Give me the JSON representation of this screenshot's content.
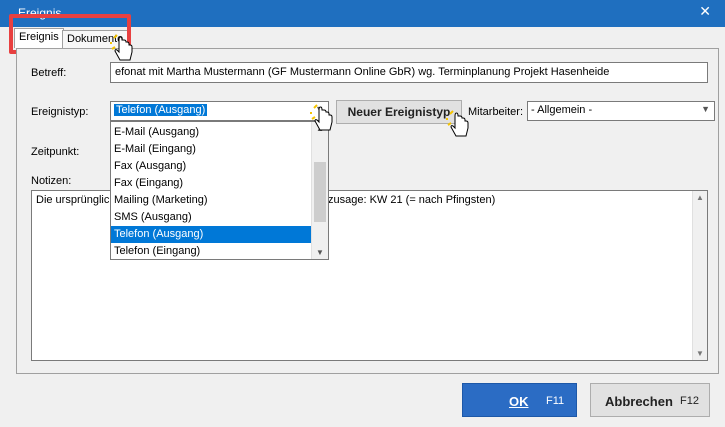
{
  "window": {
    "title": "Ereignis",
    "close_glyph": "✕"
  },
  "tabs": [
    {
      "label": "Ereignis",
      "active": true
    },
    {
      "label": "Dokumente",
      "active": false
    }
  ],
  "form": {
    "betreff_label": "Betreff:",
    "betreff_value": "Telefonat mit Martha Mustermann (GF Mustermann Online GbR) wg. Terminplanung Projekt Hasenheide",
    "betreff_visible": "efonat mit Martha Mustermann (GF Mustermann Online GbR) wg. Terminplanung Projekt Hasenheide",
    "ereignistyp_label": "Ereignistyp:",
    "ereignistyp_value": "Telefon (Ausgang)",
    "neuer_ereignistyp_button": "Neuer Ereignistyp",
    "mitarbeiter_label": "Mitarbeiter:",
    "mitarbeiter_value": "- Allgemein -",
    "zeitpunkt_label": "Zeitpunkt:",
    "notizen_label": "Notizen:",
    "notizen_left": "Die ursprüngliche",
    "notizen_right": "zusage: KW 21 (= nach Pfingsten)"
  },
  "dropdown": {
    "items": [
      {
        "label": "E-Mail (Ausgang)",
        "selected": false
      },
      {
        "label": "E-Mail (Eingang)",
        "selected": false
      },
      {
        "label": "Fax (Ausgang)",
        "selected": false
      },
      {
        "label": "Fax (Eingang)",
        "selected": false
      },
      {
        "label": "Mailing (Marketing)",
        "selected": false
      },
      {
        "label": "SMS (Ausgang)",
        "selected": false
      },
      {
        "label": "Telefon (Ausgang)",
        "selected": true
      },
      {
        "label": "Telefon (Eingang)",
        "selected": false
      }
    ]
  },
  "buttons": {
    "ok_label": "OK",
    "ok_key": "F11",
    "cancel_label": "Abbrechen",
    "cancel_key": "F12"
  },
  "colors": {
    "titlebar": "#1f6fbf",
    "accent": "#0078d7",
    "highlight": "#e84040",
    "ok_button": "#2b6cc4"
  }
}
